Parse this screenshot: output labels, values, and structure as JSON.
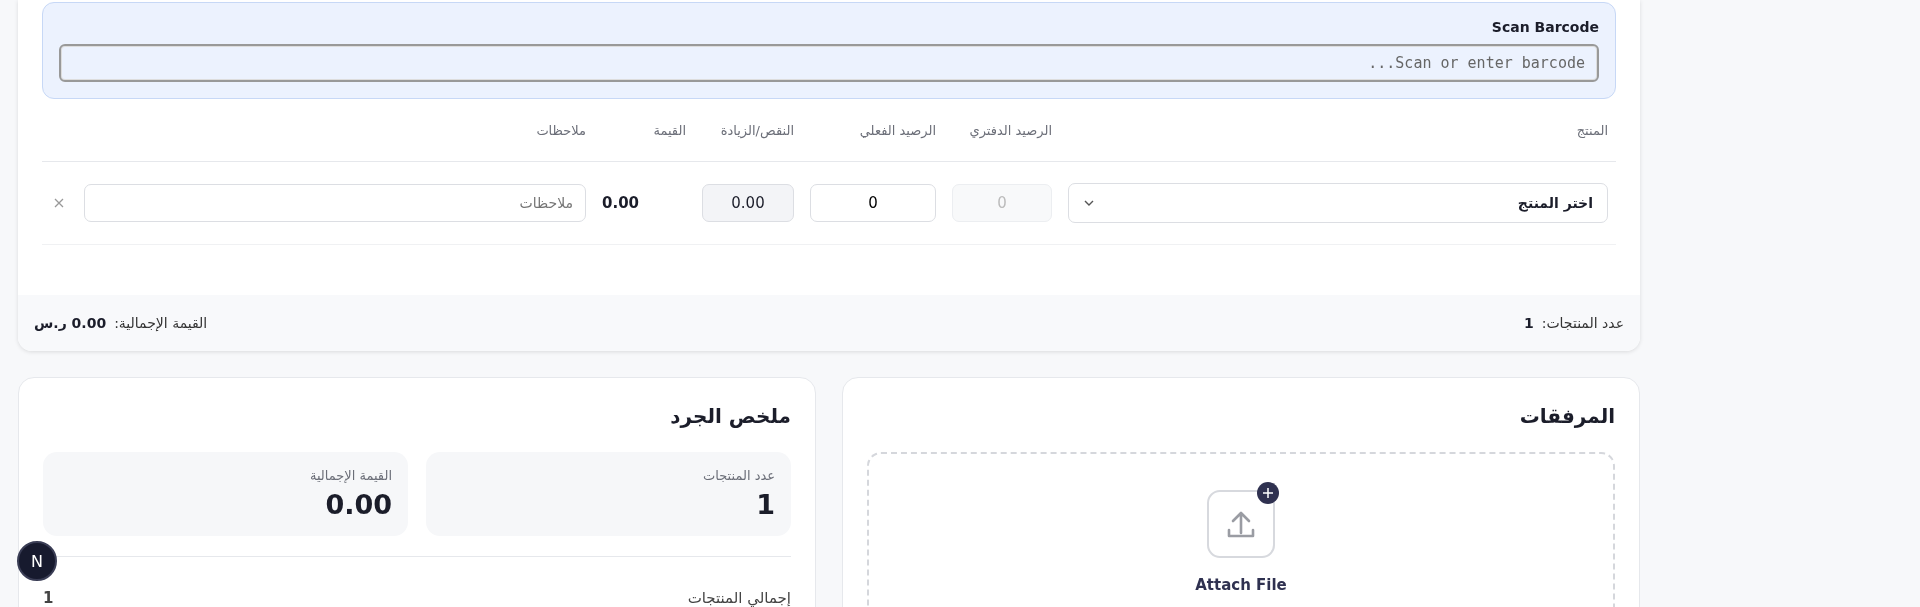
{
  "barcode": {
    "label": "Scan Barcode",
    "placeholder": "Scan or enter barcode..."
  },
  "table": {
    "columns": [
      "المنتج",
      "الرصيد الدفتري",
      "الرصيد الفعلي",
      "النقص/الزيادة",
      "القيمة",
      "ملاحظات"
    ],
    "rows": [
      {
        "product": "اختر المنتج",
        "book_balance": "0",
        "actual_balance": "0",
        "difference": "0.00",
        "value": "0.00",
        "notes_placeholder": "ملاحظات"
      }
    ]
  },
  "footer": {
    "count_label": "عدد المنتجات:",
    "count": "1",
    "total_label": "القيمة الإجمالية:",
    "total": "0.00 ر.س"
  },
  "summary": {
    "title": "ملخص الجرد",
    "stats": [
      {
        "label": "عدد المنتجات",
        "value": "1"
      },
      {
        "label": "القيمة الإجمالية",
        "value": "0.00"
      }
    ],
    "rows": [
      {
        "label": "إجمالي المنتجات",
        "value": "1"
      }
    ]
  },
  "attachments": {
    "title": "المرفقات",
    "action": "Attach File"
  },
  "floating_badge": "N"
}
